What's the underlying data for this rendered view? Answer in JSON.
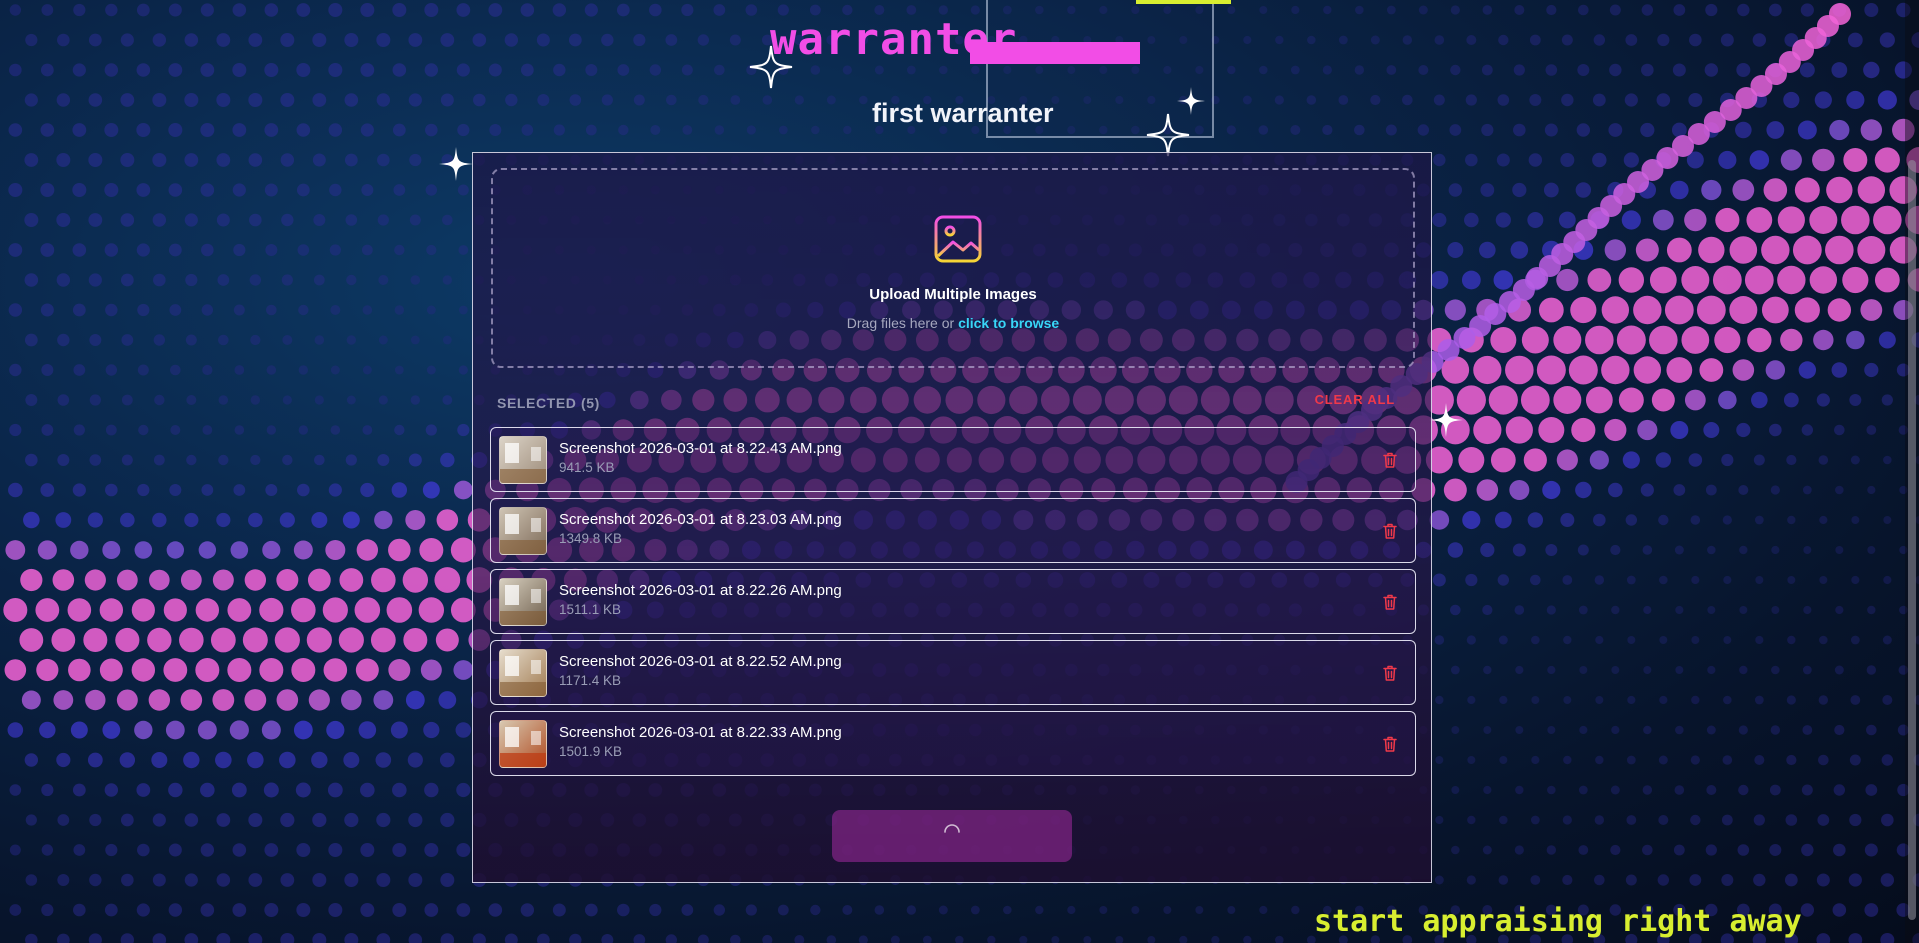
{
  "brand": {
    "title": "warranter"
  },
  "header": {
    "subtitle": "first warranter"
  },
  "uploader": {
    "title": "Upload Multiple Images",
    "prompt": "Drag files here or",
    "browse_link": "click to browse",
    "icon": "image-icon"
  },
  "selection": {
    "label": "SELECTED (5)",
    "clear_label": "CLEAR ALL",
    "files": [
      {
        "name": "Screenshot 2026-03-01 at 8.22.43 AM.png",
        "size": "941.5 KB"
      },
      {
        "name": "Screenshot 2026-03-01 at 8.23.03 AM.png",
        "size": "1349.8 KB"
      },
      {
        "name": "Screenshot 2026-03-01 at 8.22.26 AM.png",
        "size": "1511.1 KB"
      },
      {
        "name": "Screenshot 2026-03-01 at 8.22.52 AM.png",
        "size": "1171.4 KB"
      },
      {
        "name": "Screenshot 2026-03-01 at 8.22.33 AM.png",
        "size": "1501.9 KB"
      }
    ]
  },
  "footer": {
    "tagline": "start appraising right away"
  },
  "colors": {
    "accent_pink": "#f24de6",
    "accent_yellow": "#d8ee30",
    "link_cyan": "#38d6f7",
    "danger_red": "#f0394a"
  }
}
